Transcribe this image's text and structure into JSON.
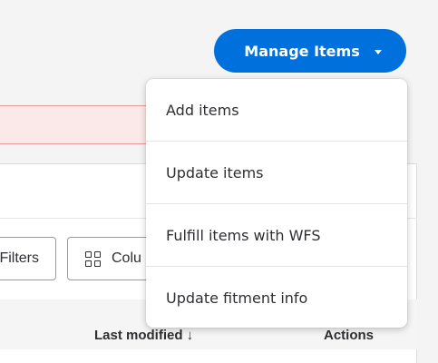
{
  "manage_button": {
    "label": "Manage Items",
    "icon": "caret-down-icon"
  },
  "dropdown": {
    "items": [
      {
        "label": "Add items"
      },
      {
        "label": "Update items"
      },
      {
        "label": "Fulfill items with WFS"
      },
      {
        "label": "Update fitment info"
      }
    ]
  },
  "toolbar": {
    "filters_label": "Filters",
    "columns_label": "Colu",
    "columns_icon": "grid-icon"
  },
  "table": {
    "headers": {
      "last_modified": "Last modified ↓",
      "actions": "Actions"
    }
  },
  "colors": {
    "primary": "#0071dc",
    "alert_bg": "#fbe8e8",
    "alert_border": "#e89c9c"
  }
}
